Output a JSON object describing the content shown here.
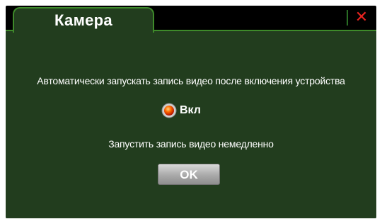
{
  "window": {
    "title": "Камера",
    "close_icon": "close-icon"
  },
  "dialog": {
    "question": "Автоматически запускать запись видео после включения устройства",
    "option": {
      "label": "Вкл",
      "selected": true,
      "icon": "radio-selected-icon"
    },
    "subtitle": "Запустить запись видео немедленно",
    "ok_label": "OK"
  },
  "colors": {
    "panel_bg": "#223d1e",
    "border_green": "#3e8a2a",
    "close_red": "#e8231f"
  }
}
